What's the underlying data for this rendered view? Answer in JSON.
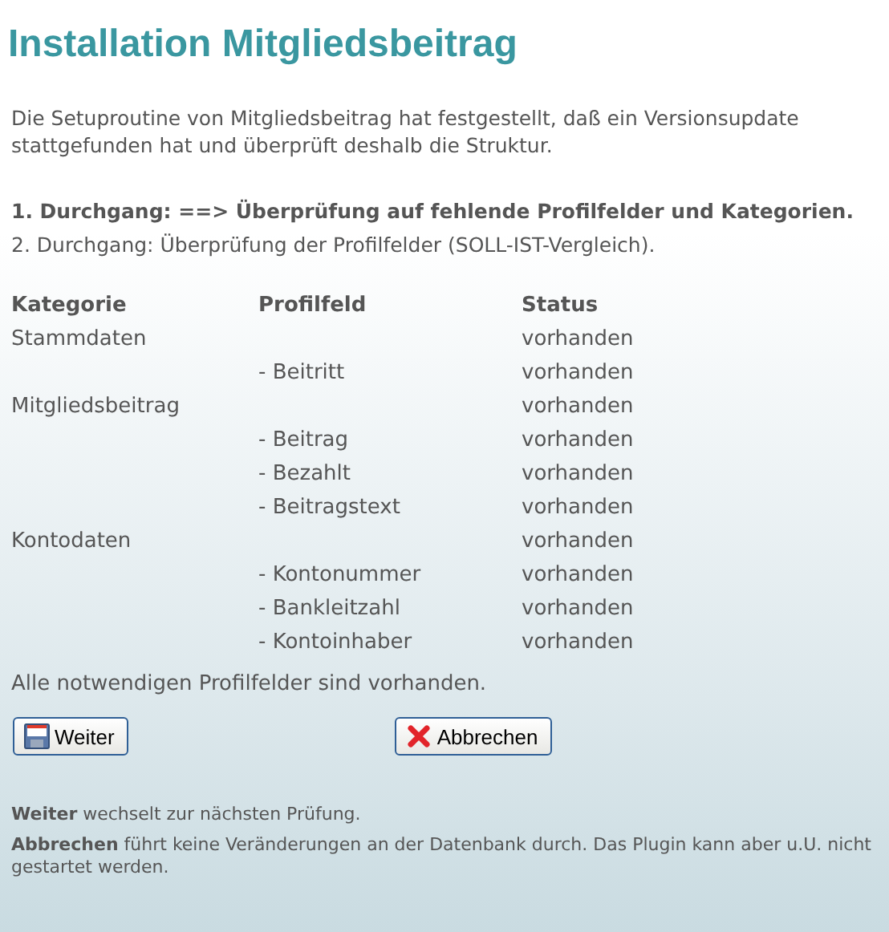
{
  "title": "Installation Mitgliedsbeitrag",
  "intro": "Die Setuproutine von Mitgliedsbeitrag hat festgestellt, daß ein Versionsupdate stattgefunden hat und überprüft deshalb die Struktur.",
  "passes": [
    {
      "text": "1. Durchgang: ==> Überprüfung auf fehlende Profilfelder und Kategorien.",
      "selected": true
    },
    {
      "text": "2. Durchgang: Überprüfung der Profilfelder (SOLL-IST-Vergleich).",
      "selected": false
    }
  ],
  "table": {
    "columns": [
      "Kategorie",
      "Profilfeld",
      "Status"
    ],
    "rows": [
      {
        "kategorie": "Stammdaten",
        "status": "vorhanden"
      },
      {
        "profilfeld": "- Beitritt",
        "status": "vorhanden"
      },
      {
        "kategorie": "Mitgliedsbeitrag",
        "status": "vorhanden"
      },
      {
        "profilfeld": "- Beitrag",
        "status": "vorhanden"
      },
      {
        "profilfeld": "- Bezahlt",
        "status": "vorhanden"
      },
      {
        "profilfeld": "- Beitragstext",
        "status": "vorhanden"
      },
      {
        "kategorie": "Kontodaten",
        "status": "vorhanden"
      },
      {
        "profilfeld": "- Kontonummer",
        "status": "vorhanden"
      },
      {
        "profilfeld": "- Bankleitzahl",
        "status": "vorhanden"
      },
      {
        "profilfeld": "- Kontoinhaber",
        "status": "vorhanden"
      }
    ]
  },
  "result": "Alle notwendigen Profilfelder sind vorhanden.",
  "buttons": [
    {
      "label": "Weiter",
      "kind": "save"
    },
    {
      "label": "Abbrechen",
      "kind": "cancel"
    }
  ],
  "notes": [
    "**Weiter** wechselt zur nächsten Prüfung.",
    "**Abbrechen** führt keine Veränderungen an der Datenbank durch. Das Plugin kann aber u.U. nicht gestartet werden."
  ]
}
